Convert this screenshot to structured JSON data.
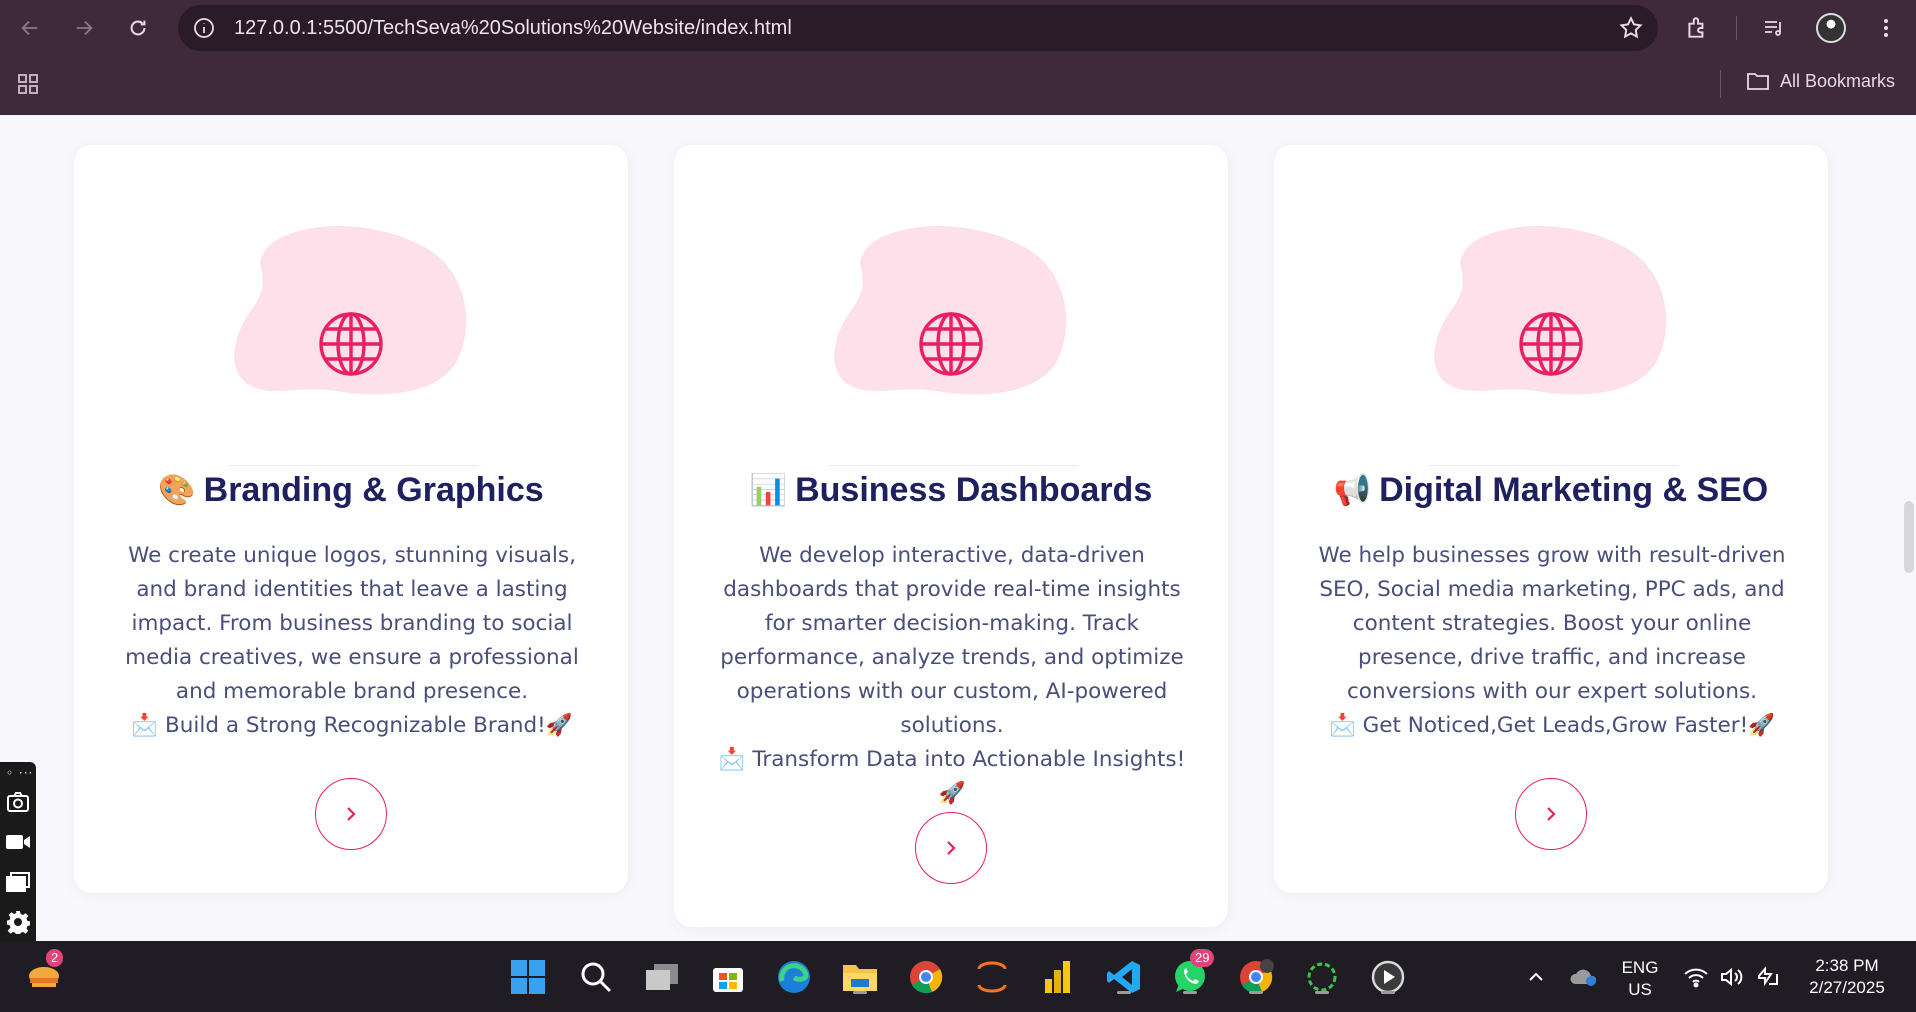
{
  "browser": {
    "url": "127.0.0.1:5500/TechSeva%20Solutions%20Website/index.html",
    "bookmarks_label": "All Bookmarks"
  },
  "cards": [
    {
      "emoji": "🎨",
      "title": "Branding & Graphics",
      "description": "We create unique logos, stunning visuals, and brand identities that leave a lasting impact. From business branding to social media creatives, we ensure a professional and memorable brand presence.",
      "cta_emoji": "📩",
      "cta_text": "Build a Strong Recognizable Brand!",
      "cta_end": "🚀"
    },
    {
      "emoji": "📊",
      "title": "Business Dashboards",
      "description": "We develop interactive, data-driven dashboards that provide real-time insights for smarter decision-making. Track performance, analyze trends, and optimize operations with our custom, AI-powered solutions.",
      "cta_emoji": "📩",
      "cta_text": "Transform Data into Actionable Insights!",
      "cta_end": "🚀"
    },
    {
      "emoji": "📢",
      "title": "Digital Marketing & SEO",
      "description": "We help businesses grow with result-driven SEO, Social media marketing, PPC ads, and content strategies. Boost your online presence, drive traffic, and increase conversions with our expert solutions.",
      "cta_emoji": "📩",
      "cta_text": "Get Noticed,Get Leads,Grow Faster!",
      "cta_end": "🚀"
    }
  ],
  "colors": {
    "accent": "#e91e63",
    "title": "#1e2060",
    "text": "#4a4e7a",
    "blob": "#fde0ea",
    "browser_bg": "#3f2a3b"
  },
  "taskbar": {
    "weather_badge": "2",
    "whatsapp_badge": "29",
    "language": "ENG",
    "region": "US",
    "time": "2:38 PM",
    "date": "2/27/2025"
  }
}
